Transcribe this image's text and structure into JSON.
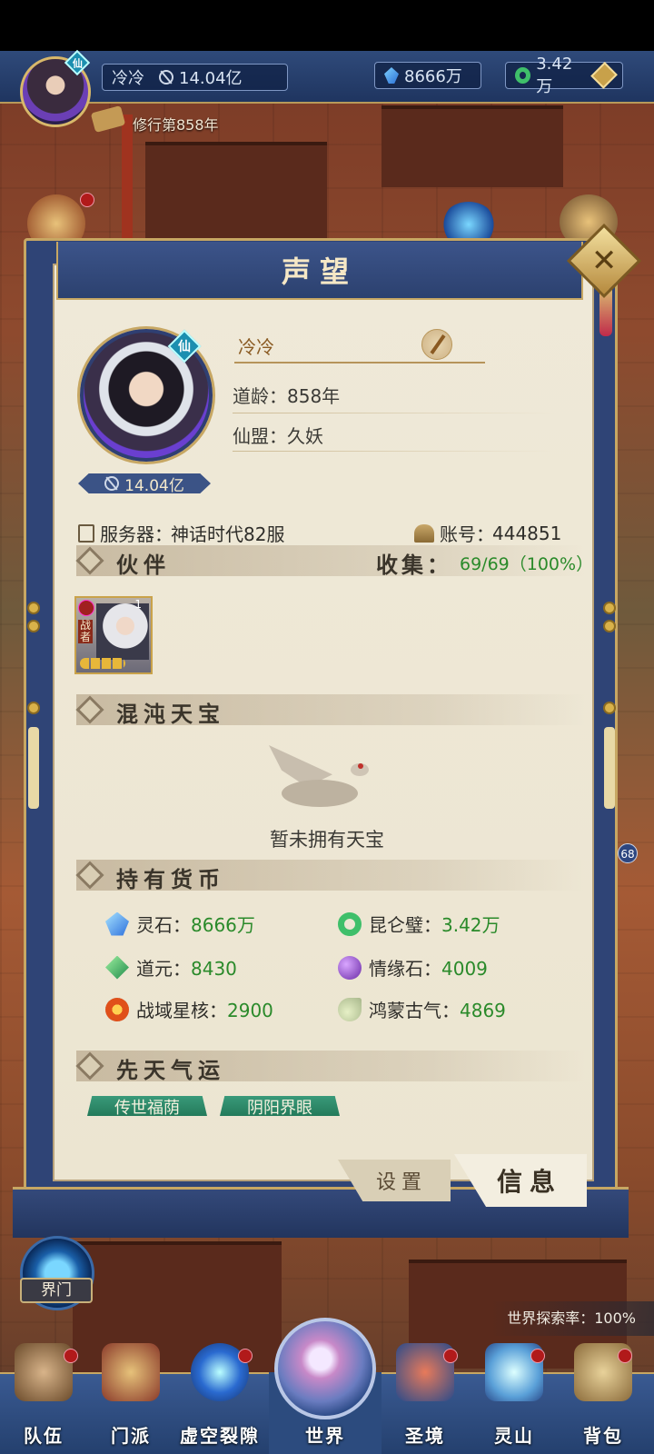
{
  "topbar": {
    "player_name": "冷冷",
    "power": "14.04亿",
    "spirit_stone": "8666万",
    "jade": "3.42万",
    "cultivation_year": "修行第858年",
    "xian_badge": "仙"
  },
  "panel": {
    "title": "声望",
    "close_label": "✕"
  },
  "profile": {
    "name": "冷冷",
    "dao_age_label": "道龄：",
    "dao_age_value": "858年",
    "alliance_label": "仙盟：",
    "alliance_value": "久妖",
    "power": "14.04亿",
    "server_label": "服务器：",
    "server_value": "神话时代82服",
    "account_label": "账号：",
    "account_value": "444851"
  },
  "partners": {
    "title": "伙伴",
    "collect_label": "收集：",
    "collect_value": "69/69（100%）",
    "items": [
      {
        "type": "战者",
        "level": "1"
      }
    ]
  },
  "treasure": {
    "title": "混沌天宝",
    "empty_text": "暂未拥有天宝"
  },
  "currency": {
    "title": "持有货币",
    "items": [
      {
        "label": "灵石：",
        "value": "8666万",
        "icon": "spirit-stone-icon"
      },
      {
        "label": "昆仑璧：",
        "value": "3.42万",
        "icon": "kunlun-jade-icon"
      },
      {
        "label": "道元：",
        "value": "8430",
        "icon": "dao-yuan-icon"
      },
      {
        "label": "情缘石：",
        "value": "4009",
        "icon": "love-stone-icon"
      },
      {
        "label": "战域星核：",
        "value": "2900",
        "icon": "star-core-icon"
      },
      {
        "label": "鸿蒙古气：",
        "value": "4869",
        "icon": "primordial-qi-icon"
      }
    ]
  },
  "fortune": {
    "title": "先天气运",
    "items": [
      "传世福荫",
      "阴阳界眼"
    ]
  },
  "tabs": {
    "settings": "设置",
    "info": "信息"
  },
  "hud": {
    "portal_label": "界门",
    "explore_rate": "世界探索率：100%",
    "side_badge": "68"
  },
  "nav": {
    "items": [
      "队伍",
      "门派",
      "虚空裂隙",
      "世界",
      "圣境",
      "灵山",
      "背包"
    ]
  }
}
